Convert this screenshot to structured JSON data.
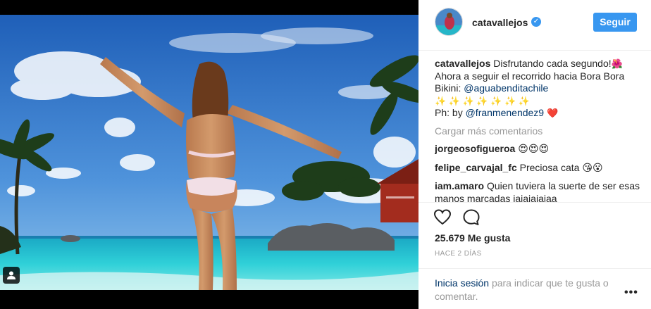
{
  "post": {
    "username": "catavallejos",
    "follow_label": "Seguir",
    "verified_mark": "✓"
  },
  "caption": {
    "username": "catavallejos",
    "line1": "Disfrutando cada segundo!",
    "line1_emoji": "🌺",
    "line2": "Ahora a seguir el recorrido hacia Bora Bora",
    "line3_prefix": "Bikini:",
    "line3_mention": "@aguabenditachile",
    "line4": "✨ ✨ ✨ ✨ ✨ ✨ ✨",
    "line5_prefix": "Ph: by",
    "line5_mention": "@franmenendez9",
    "line5_emoji": "❤️"
  },
  "load_more": "Cargar más comentarios",
  "comments": [
    {
      "user": "jorgeosofigueroa",
      "text": "😍😍😍"
    },
    {
      "user": "felipe_carvajal_fc",
      "text": "Preciosa cata 😘😮"
    },
    {
      "user": "iam.amaro",
      "text": "Quien tuviera la suerte de ser esas manos marcadas jajajajajaa"
    }
  ],
  "likes": "25.679 Me gusta",
  "time": "HACE 2 DÍAS",
  "login": {
    "link": "Inicia sesión",
    "rest": "para indicar que te gusta o comentar."
  },
  "more_options": "•••",
  "icons": {
    "heart": "heart-icon",
    "comment": "comment-icon",
    "user_tag": "user-tag-icon",
    "verified": "verified-badge-icon"
  },
  "colors": {
    "accent": "#3897f0",
    "link": "#003569",
    "muted": "#999999",
    "text": "#262626"
  }
}
